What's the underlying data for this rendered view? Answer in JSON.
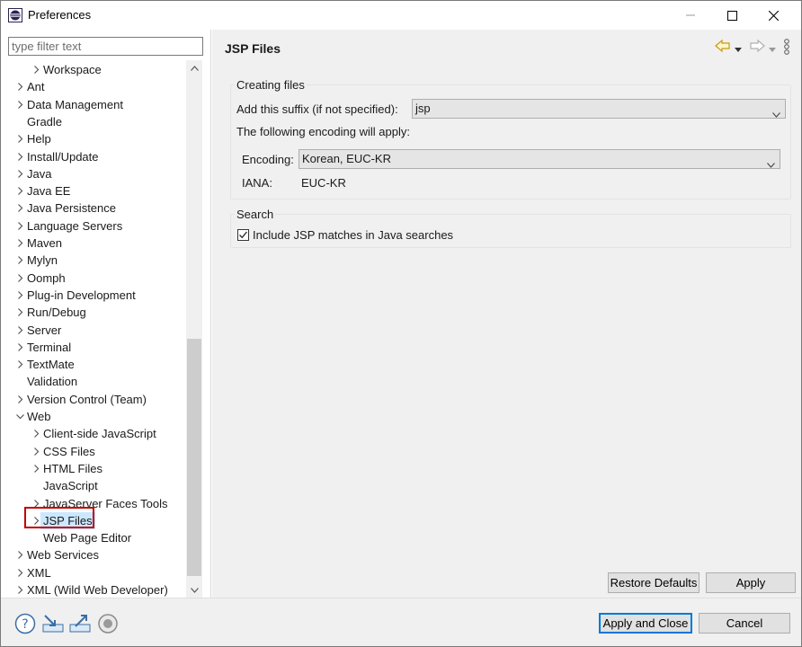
{
  "window": {
    "title": "Preferences"
  },
  "filter": {
    "placeholder": "type filter text"
  },
  "tree": {
    "items": [
      {
        "label": "Workspace",
        "level": 1,
        "expander": "collapsed"
      },
      {
        "label": "Ant",
        "level": 0,
        "expander": "collapsed"
      },
      {
        "label": "Data Management",
        "level": 0,
        "expander": "collapsed"
      },
      {
        "label": "Gradle",
        "level": 0,
        "expander": "none"
      },
      {
        "label": "Help",
        "level": 0,
        "expander": "collapsed"
      },
      {
        "label": "Install/Update",
        "level": 0,
        "expander": "collapsed"
      },
      {
        "label": "Java",
        "level": 0,
        "expander": "collapsed"
      },
      {
        "label": "Java EE",
        "level": 0,
        "expander": "collapsed"
      },
      {
        "label": "Java Persistence",
        "level": 0,
        "expander": "collapsed"
      },
      {
        "label": "Language Servers",
        "level": 0,
        "expander": "collapsed"
      },
      {
        "label": "Maven",
        "level": 0,
        "expander": "collapsed"
      },
      {
        "label": "Mylyn",
        "level": 0,
        "expander": "collapsed"
      },
      {
        "label": "Oomph",
        "level": 0,
        "expander": "collapsed"
      },
      {
        "label": "Plug-in Development",
        "level": 0,
        "expander": "collapsed"
      },
      {
        "label": "Run/Debug",
        "level": 0,
        "expander": "collapsed"
      },
      {
        "label": "Server",
        "level": 0,
        "expander": "collapsed"
      },
      {
        "label": "Terminal",
        "level": 0,
        "expander": "collapsed"
      },
      {
        "label": "TextMate",
        "level": 0,
        "expander": "collapsed"
      },
      {
        "label": "Validation",
        "level": 0,
        "expander": "none"
      },
      {
        "label": "Version Control (Team)",
        "level": 0,
        "expander": "collapsed"
      },
      {
        "label": "Web",
        "level": 0,
        "expander": "expanded"
      },
      {
        "label": "Client-side JavaScript",
        "level": 1,
        "expander": "collapsed"
      },
      {
        "label": "CSS Files",
        "level": 1,
        "expander": "collapsed"
      },
      {
        "label": "HTML Files",
        "level": 1,
        "expander": "collapsed"
      },
      {
        "label": "JavaScript",
        "level": 1,
        "expander": "none"
      },
      {
        "label": "JavaServer Faces Tools",
        "level": 1,
        "expander": "collapsed"
      },
      {
        "label": "JSP Files",
        "level": 1,
        "expander": "collapsed",
        "selected": true
      },
      {
        "label": "Web Page Editor",
        "level": 1,
        "expander": "none"
      },
      {
        "label": "Web Services",
        "level": 0,
        "expander": "collapsed"
      },
      {
        "label": "XML",
        "level": 0,
        "expander": "collapsed"
      },
      {
        "label": "XML (Wild Web Developer)",
        "level": 0,
        "expander": "collapsed"
      }
    ]
  },
  "page": {
    "title": "JSP Files",
    "creating_files": {
      "title": "Creating files",
      "suffix_label": "Add this suffix (if not specified):",
      "suffix_value": "jsp",
      "encoding_note": "The following encoding will apply:",
      "encoding_label": "Encoding:",
      "encoding_value": "Korean, EUC-KR",
      "iana_label": "IANA:",
      "iana_value": "EUC-KR"
    },
    "search": {
      "title": "Search",
      "include_label": "Include JSP matches in Java searches",
      "include_checked": true
    },
    "restore_defaults_label": "Restore Defaults",
    "apply_label": "Apply"
  },
  "footer": {
    "apply_and_close_label": "Apply and Close",
    "cancel_label": "Cancel",
    "icons": [
      "help-icon",
      "import-icon",
      "export-icon",
      "record-icon"
    ]
  },
  "colors": {
    "selection": "#cce8ff",
    "highlight_box": "#c00000",
    "default_button_border": "#0078d7",
    "back_arrow": "#d4a017"
  }
}
